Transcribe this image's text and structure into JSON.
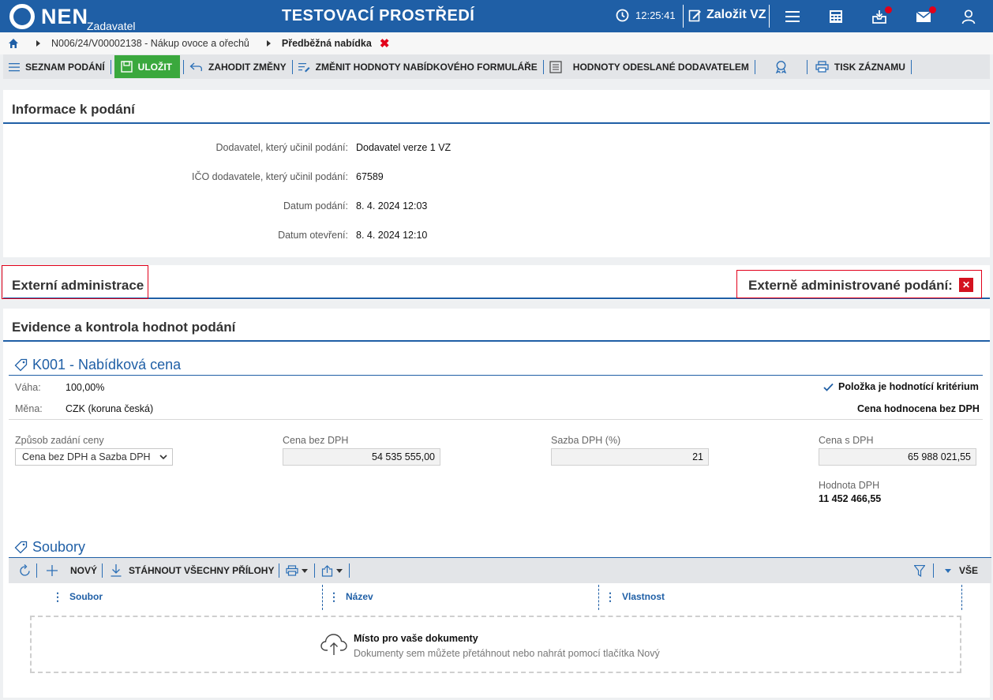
{
  "header": {
    "logo_text": "NEN",
    "logo_sub": "Zadavatel",
    "env_title": "TESTOVACÍ PROSTŘEDÍ",
    "time": "12:25:41",
    "create_label": "Založit VZ",
    "icons": [
      "clock-icon",
      "edit-icon",
      "menu-icon",
      "calculator-icon",
      "inbox-icon",
      "mail-icon",
      "user-icon"
    ],
    "accent_color": "#1f5fa6",
    "badge_color": "#e2001a"
  },
  "breadcrumb": {
    "item1": "N006/24/V00002138 - Nákup ovoce a ořechů",
    "current": "Předběžná nabídka",
    "close": "✖"
  },
  "toolbar": {
    "list_label": "SEZNAM PODÁNÍ",
    "save_label": "ULOŽIT",
    "discard_label": "ZAHODIT ZMĚNY",
    "change_label": "ZMĚNIT HODNOTY NABÍDKOVÉHO FORMULÁŘE",
    "sent_values_label": "HODNOTY ODESLANÉ DODAVATELEM",
    "print_label": "TISK ZÁZNAMU"
  },
  "info": {
    "title": "Informace k podání",
    "rows": [
      {
        "label": "Dodavatel, který učinil podání:",
        "value": "Dodavatel verze 1 VZ"
      },
      {
        "label": "IČO dodavatele, který učinil podání:",
        "value": "67589"
      },
      {
        "label": "Datum podání:",
        "value": "8. 4. 2024 12:03"
      },
      {
        "label": "Datum otevření:",
        "value": "8. 4. 2024 12:10"
      }
    ]
  },
  "external": {
    "title": "Externí administrace",
    "flag_label": "Externě administrované podání:",
    "flag_value": "✕"
  },
  "evidence": {
    "title": "Evidence a kontrola hodnot podání",
    "criterion_title": "K001 - Nabídková cena",
    "weight_label": "Váha:",
    "weight_value": "100,00%",
    "currency_label": "Měna:",
    "currency_value": "CZK (koruna česká)",
    "criterion_flag": "Položka je hodnotící kritérium",
    "price_basis": "Cena hodnocena bez DPH",
    "price_mode_label": "Způsob zadání ceny",
    "price_mode_value": "Cena bez DPH a Sazba DPH",
    "net_label": "Cena bez DPH",
    "net_value": "54 535 555,00",
    "vat_rate_label": "Sazba DPH (%)",
    "vat_rate_value": "21",
    "gross_label": "Cena s DPH",
    "gross_value": "65 988 021,55",
    "vat_label": "Hodnota DPH",
    "vat_value": "11 452 466,55"
  },
  "files": {
    "title": "Soubory",
    "new_label": "NOVÝ",
    "download_label": "STÁHNOUT VŠECHNY PŘÍLOHY",
    "all_label": "VŠE",
    "columns": [
      "Soubor",
      "Název",
      "Vlastnost"
    ],
    "drop_title": "Místo pro vaše dokumenty",
    "drop_text": "Dokumenty sem můžete přetáhnout nebo nahrát pomocí tlačítka Nový"
  }
}
